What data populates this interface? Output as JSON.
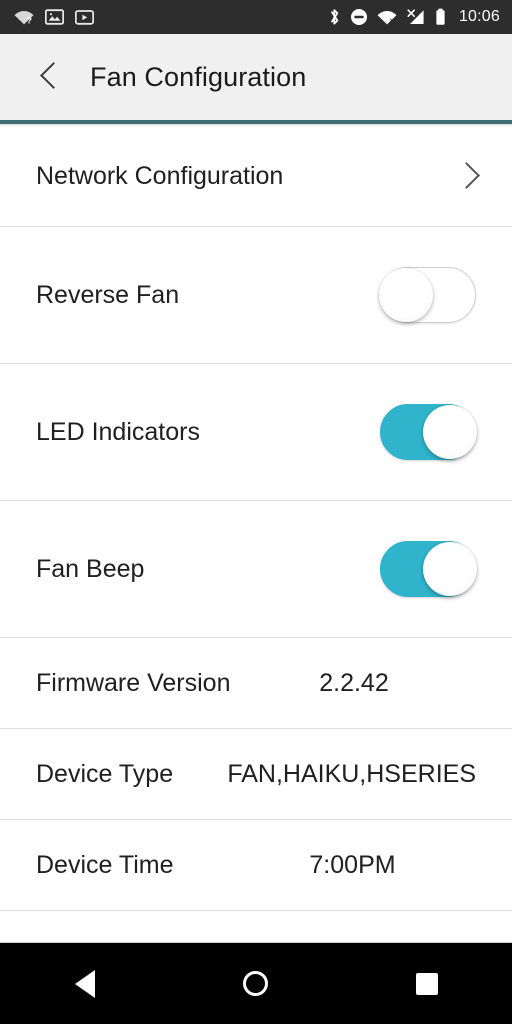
{
  "status_bar": {
    "left_icons": [
      "wifi-question-icon",
      "photos-icon",
      "youtube-icon"
    ],
    "right_icons": [
      "bluetooth-icon",
      "do-not-disturb-icon",
      "wifi-off-icon",
      "cellular-off-icon",
      "battery-icon"
    ],
    "time": "10:06"
  },
  "header": {
    "back_icon": "chevron-left-icon",
    "title": "Fan Configuration",
    "accent_color": "#3e6b74"
  },
  "colors": {
    "accent": "#3e6b74",
    "toggle_on": "#2fb4cc",
    "header_bg": "#f0f0f0",
    "status_bg": "#2d2d2d"
  },
  "settings": {
    "network": {
      "label": "Network Configuration",
      "chevron_icon": "chevron-right-icon"
    },
    "reverse_fan": {
      "label": "Reverse Fan",
      "state": "off"
    },
    "led_indicators": {
      "label": "LED Indicators",
      "state": "on"
    },
    "fan_beep": {
      "label": "Fan Beep",
      "state": "on"
    },
    "firmware_version": {
      "label": "Firmware Version",
      "value": "2.2.42"
    },
    "device_type": {
      "label": "Device Type",
      "value": "FAN,HAIKU,HSERIES"
    },
    "device_time": {
      "label": "Device Time",
      "value": "7:00PM"
    }
  },
  "nav_bar": {
    "back_icon": "nav-back-icon",
    "home_icon": "nav-home-icon",
    "recents_icon": "nav-recents-icon"
  }
}
